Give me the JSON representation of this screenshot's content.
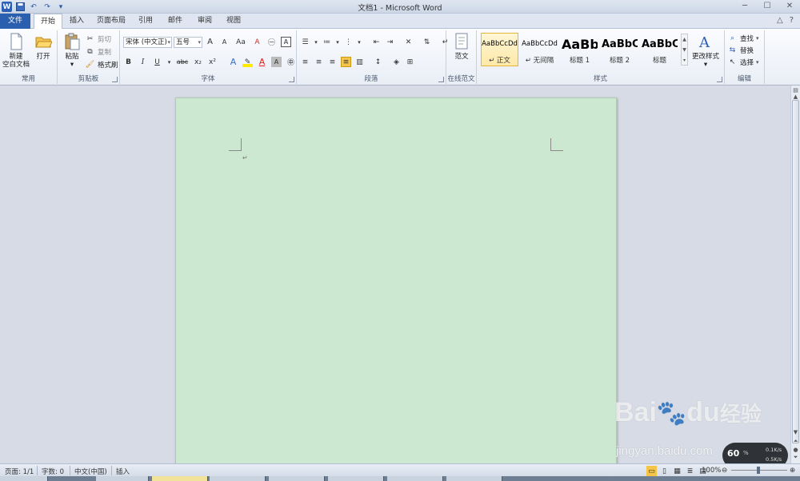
{
  "window": {
    "title": "文档1 - Microsoft Word"
  },
  "qat": {
    "undo": "↶",
    "redo": "↷",
    "save": "💾"
  },
  "tabs": [
    "文件",
    "开始",
    "插入",
    "页面布局",
    "引用",
    "邮件",
    "审阅",
    "视图"
  ],
  "ribbon": {
    "common": {
      "label": "常用",
      "new_blank": "新建\n空白文档",
      "new_blank_l1": "新建",
      "new_blank_l2": "空白文档",
      "open": "打开"
    },
    "clipboard": {
      "label": "剪贴板",
      "paste": "粘贴",
      "cut": "剪切",
      "copy": "复制",
      "format_painter": "格式刷"
    },
    "font": {
      "label": "字体",
      "font_name": "宋体 (中文正)",
      "font_size": "五号",
      "grow": "A",
      "shrink": "A",
      "case": "Aa",
      "clear": "A",
      "bold": "B",
      "italic": "I",
      "underline": "U",
      "strike": "abc",
      "sub": "x₂",
      "sup": "x²"
    },
    "paragraph": {
      "label": "段落"
    },
    "online": {
      "label": "在线范文",
      "sample": "范文"
    },
    "styles": {
      "label": "样式",
      "items": [
        {
          "sample": "AaBbCcDd",
          "name": "↵ 正文"
        },
        {
          "sample": "AaBbCcDd",
          "name": "↵ 无间隔"
        },
        {
          "sample": "AaBb",
          "name": "标题 1"
        },
        {
          "sample": "AaBbC",
          "name": "标题 2"
        },
        {
          "sample": "AaBbC",
          "name": "标题"
        }
      ],
      "change_styles": "更改样式"
    },
    "editing": {
      "label": "编辑",
      "find": "查找",
      "replace": "替换",
      "select": "选择"
    }
  },
  "document": {
    "paragraph_mark": "↵"
  },
  "statusbar": {
    "page": "页面: 1/1",
    "words": "字数: 0",
    "lang": "中文(中国)",
    "mode": "插入",
    "zoom": "100%"
  },
  "watermark": {
    "brand": "Bai",
    "brand2": "du",
    "brand3": "经验",
    "url": "jingyan.baidu.com"
  },
  "network": {
    "percent": "60",
    "up": "0.1K/s",
    "down": "0.5K/s"
  }
}
